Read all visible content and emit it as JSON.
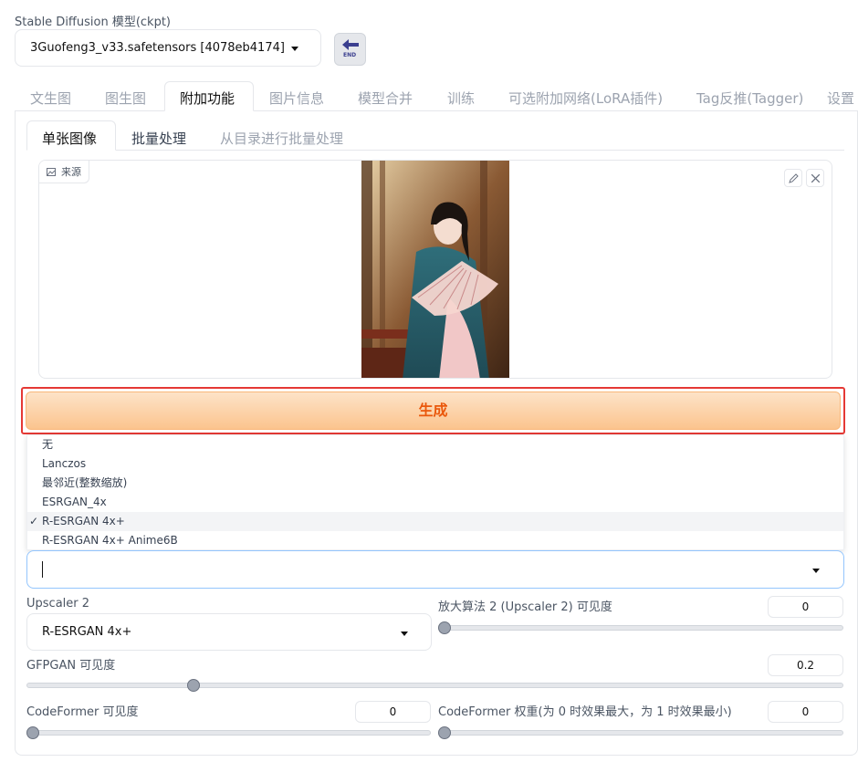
{
  "model": {
    "label": "Stable Diffusion 模型(ckpt)",
    "selected": "3Guofeng3_v33.safetensors [4078eb4174]",
    "end_icon_text": "END"
  },
  "tabs": [
    {
      "label": "文生图"
    },
    {
      "label": "图生图"
    },
    {
      "label": "附加功能",
      "active": true
    },
    {
      "label": "图片信息"
    },
    {
      "label": "模型合并"
    },
    {
      "label": "训练"
    },
    {
      "label": "可选附加网络(LoRA插件)"
    },
    {
      "label": "Tag反推(Tagger)"
    },
    {
      "label": "设置"
    }
  ],
  "subtabs": [
    {
      "label": "单张图像",
      "active": true
    },
    {
      "label": "批量处理"
    },
    {
      "label": "从目录进行批量处理"
    }
  ],
  "source_panel": {
    "label": "来源"
  },
  "generate_button": {
    "label": "生成"
  },
  "upscaler_options": [
    {
      "label": "无"
    },
    {
      "label": "Lanczos"
    },
    {
      "label": "最邻近(整数缩放)"
    },
    {
      "label": "ESRGAN_4x"
    },
    {
      "label": "R-ESRGAN 4x+",
      "checked": true,
      "check": "✓"
    },
    {
      "label": "R-ESRGAN 4x+ Anime6B"
    }
  ],
  "upscaler1_input": {
    "value": ""
  },
  "upscaler2": {
    "label": "Upscaler 2",
    "selected": "R-ESRGAN 4x+"
  },
  "upscaler2_visibility": {
    "label": "放大算法 2 (Upscaler 2) 可见度",
    "value": "0",
    "fraction": 0
  },
  "gfpgan": {
    "label": "GFPGAN 可见度",
    "value": "0.2",
    "fraction": 0.2
  },
  "codeformer_visibility": {
    "label": "CodeFormer 可见度",
    "value": "0",
    "fraction": 0
  },
  "codeformer_weight": {
    "label": "CodeFormer 权重(为 0 时效果最大，为 1 时效果最小)",
    "value": "0",
    "fraction": 0
  },
  "colors": {
    "accent": "#f97316",
    "highlight_border": "#e53935",
    "button_fill": "#fdd9b5"
  }
}
